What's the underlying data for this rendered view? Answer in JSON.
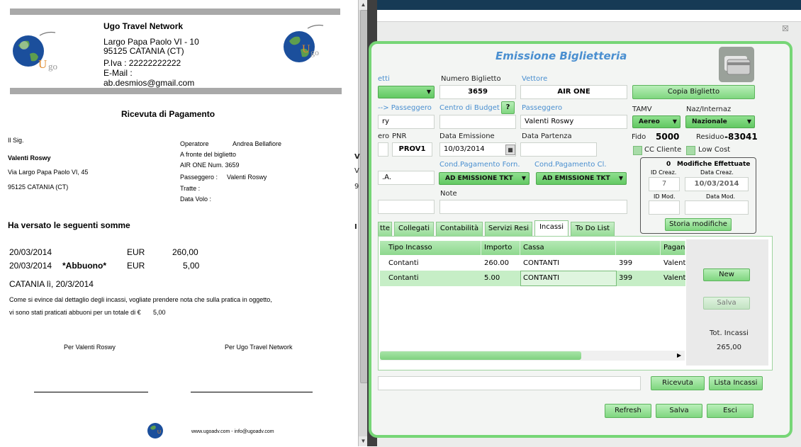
{
  "receipt": {
    "company": "Ugo Travel Network",
    "address1": "Largo Papa Paolo VI - 10",
    "address2": "95125 CATANIA (CT)",
    "piva": "P.Iva : 22222222222",
    "email_label": "E-Mail :",
    "email": "ab.desmios@gmail.com",
    "title": "Ricevuta di Pagamento",
    "sig_prefix": "Il Sig.",
    "customer_name": "Valenti Roswy",
    "customer_address": "Via Largo Papa Paolo VI, 45",
    "customer_city": "95125 CATANIA (CT)",
    "operatore_label": "Operatore",
    "operatore": "Andrea Bellafiore",
    "a_fronte": "A fronte del biglietto",
    "ticket": "AIR ONE Num. 3659",
    "passeggero_label": "Passeggero :",
    "passeggero": "Valenti Roswy",
    "tratte": "Tratte :",
    "data_volo": "Data Volo :",
    "versato": "Ha versato le seguenti somme",
    "payments": [
      {
        "date": "20/03/2014",
        "note": "",
        "currency": "EUR",
        "amount": "260,00"
      },
      {
        "date": "20/03/2014",
        "note": "*Abbuono*",
        "currency": "EUR",
        "amount": "5,00"
      }
    ],
    "place_date": "CATANIA lì, 20/3/2014",
    "notice1": "Come si evince dal dettaglio degli incassi, vogliate prendere nota che sulla pratica in oggetto,",
    "notice2": "vi sono stati praticati abbuoni per un totale di €",
    "abbuoni_total": "5,00",
    "sign_left": "Per Valenti Roswy",
    "sign_right": "Per Ugo Travel Network",
    "footer": "www.ugoadv.com - info@ugoadv.com"
  },
  "app": {
    "close": "☒",
    "title": "Emissione Biglietteria",
    "card_icon": "card-icon",
    "labels": {
      "biglietti": "etti",
      "numero_biglietto": "Numero Biglietto",
      "vettore": "Vettore",
      "passeggero_arrow": "--> Passeggero",
      "centro_budget": "Centro di Budget",
      "passeggero": "Passeggero",
      "tamv": "TAMV",
      "naz": "Naz/Internaz",
      "numero": "ero",
      "pnr": "PNR",
      "data_emissione": "Data Emissione",
      "data_partenza": "Data Partenza",
      "fido": "Fido",
      "residuo": "Residuo",
      "cc_cliente": "CC Cliente",
      "low_cost": "Low Cost",
      "cond_forn": "Cond.Pagamento Forn.",
      "cond_cl": "Cond.Pagamento Cl.",
      "note": "Note",
      "mod_count": "0",
      "mod_title": "Modifiche Effettuate",
      "id_creaz": "ID Creaz.",
      "data_creaz": "Data Creaz.",
      "id_mod": "ID Mod.",
      "data_mod": "Data Mod."
    },
    "values": {
      "numero_biglietto": "3659",
      "vettore": "AIR ONE",
      "pass_left": "ry",
      "question": "?",
      "passeggero": "Valenti Roswy",
      "tamv": "Aereo",
      "naz": "Nazionale",
      "pnr": "PROV1",
      "data_emissione": "10/03/2014",
      "fido": "5000",
      "residuo": "-83041",
      "spa": ".A.",
      "cond_forn": "AD EMISSIONE TKT",
      "cond_cl": "AD EMISSIONE TKT",
      "id_creaz": "7",
      "data_creaz": "10/03/2014"
    },
    "buttons": {
      "copia": "Copia Biglietto",
      "storia": "Storia modifiche",
      "new": "New",
      "salva_side": "Salva",
      "ricevuta": "Ricevuta",
      "lista_incassi": "Lista Incassi",
      "refresh": "Refresh",
      "salva": "Salva",
      "esci": "Esci"
    },
    "tabs": [
      "tte",
      "Collegati",
      "Contabilità",
      "Servizi Resi",
      "Incassi",
      "To Do List"
    ],
    "active_tab": "Incassi",
    "table": {
      "headers": [
        "Tipo Incasso",
        "Importo",
        "Cassa",
        "",
        "Pagan"
      ],
      "rows": [
        [
          "Contanti",
          "260.00",
          "CONTANTI",
          "399",
          "Valent"
        ],
        [
          "Contanti",
          "5.00",
          "CONTANTI",
          "399",
          "Valent"
        ]
      ]
    },
    "tot_label": "Tot. Incassi",
    "tot_value": "265,00"
  },
  "colors": {
    "accent_green": "#76d676",
    "title_blue": "#4a8fd0"
  }
}
